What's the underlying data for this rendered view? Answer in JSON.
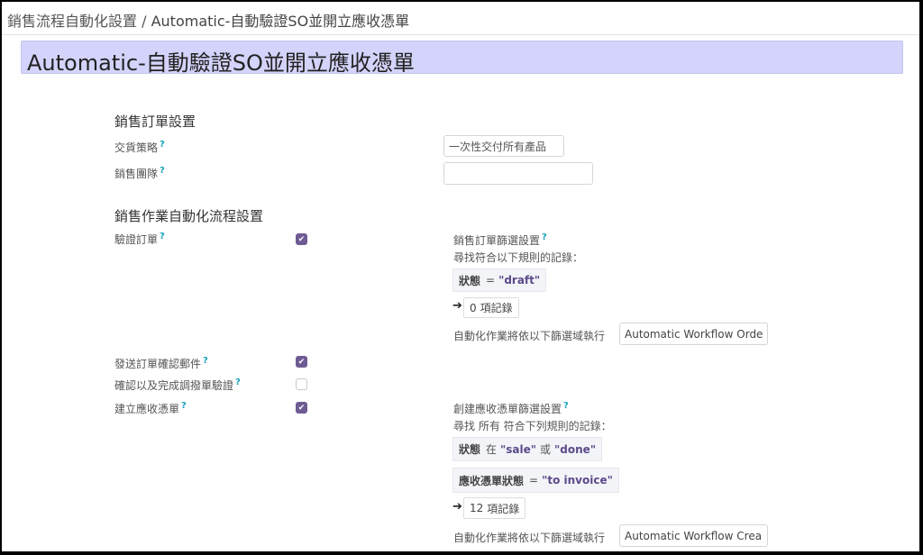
{
  "breadcrumb": {
    "parent": "銷售流程自動化設置",
    "separator": "/",
    "current": "Automatic-自動驗證SO並開立應收憑單"
  },
  "title": "Automatic-自動驗證SO並開立應收憑單",
  "sales_order_section": {
    "heading": "銷售訂單設置",
    "delivery_policy": {
      "label": "交貨策略",
      "help": "?",
      "value": "一次性交付所有產品"
    },
    "sales_team": {
      "label": "銷售團隊",
      "help": "?",
      "value": ""
    }
  },
  "automation_section": {
    "heading": "銷售作業自動化流程設置",
    "validate_order": {
      "label": "驗證訂單",
      "help": "?",
      "checked": true
    },
    "send_confirmation": {
      "label": "發送訂單確認郵件",
      "help": "?",
      "checked": true
    },
    "validate_picking": {
      "label": "確認以及完成調撥單驗證",
      "help": "?",
      "checked": false
    },
    "create_invoice": {
      "label": "建立應收憑單",
      "help": "?",
      "checked": true
    }
  },
  "order_filter": {
    "label": "銷售訂單篩選設置",
    "help": "?",
    "intro": "尋找符合以下規則的記錄：",
    "rules": [
      {
        "field": "狀態",
        "op": "=",
        "value": "\"draft\""
      }
    ],
    "records_count": "0",
    "records_label": "項記錄",
    "domain_label": "自動化作業將依以下篩選域執行",
    "domain_value": "Automatic Workflow Orde"
  },
  "invoice_filter": {
    "label": "創建應收憑單篩選設置",
    "help": "?",
    "intro": "尋找 所有 符合下列規則的記錄：",
    "rule1": {
      "field": "狀態",
      "op": "在",
      "v1": "\"sale\"",
      "or": "或",
      "v2": "\"done\""
    },
    "rule2": {
      "field": "應收憑單狀態",
      "op": "=",
      "value": "\"to invoice\""
    },
    "records_count": "12",
    "records_label": "項記錄",
    "domain_label": "自動化作業將依以下篩選域執行",
    "domain_value": "Automatic Workflow Crea"
  },
  "colors": {
    "accent": "#6e5b94",
    "title_bg": "#d3d3fb",
    "help": "#17a2b8"
  }
}
